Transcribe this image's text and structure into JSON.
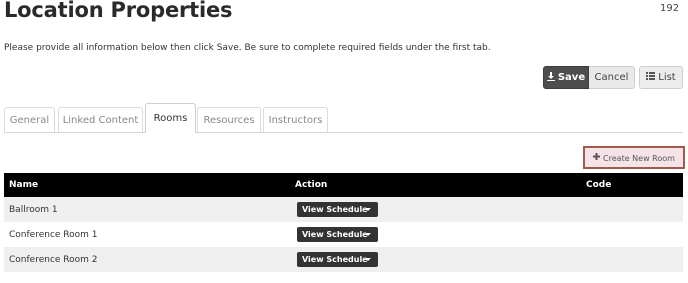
{
  "header": {
    "title": "Location Properties",
    "page_number": "192"
  },
  "instructions": "Please provide all information below then click Save. Be sure to complete required fields under the first tab.",
  "toolbar": {
    "save_label": "Save",
    "save_icon": "download-icon",
    "cancel_label": "Cancel",
    "list_label": "List",
    "list_icon": "list-icon"
  },
  "tabs": [
    {
      "label": "General"
    },
    {
      "label": "Linked Content"
    },
    {
      "label": "Rooms",
      "active": true
    },
    {
      "label": "Resources"
    },
    {
      "label": "Instructors"
    }
  ],
  "create_button": {
    "label": "Create New Room",
    "icon": "plus-icon",
    "highlight_color": "#a05a4e"
  },
  "table": {
    "columns": [
      "Name",
      "Action",
      "Code"
    ],
    "rows": [
      {
        "name": "Ballroom 1",
        "action": "View Schedule",
        "code": ""
      },
      {
        "name": "Conference Room 1",
        "action": "View Schedule",
        "code": ""
      },
      {
        "name": "Conference Room 2",
        "action": "View Schedule",
        "code": ""
      }
    ]
  },
  "colors": {
    "header_bg": "#000000",
    "save_bg": "#4d4d4d",
    "row_alt": "#efefef"
  }
}
